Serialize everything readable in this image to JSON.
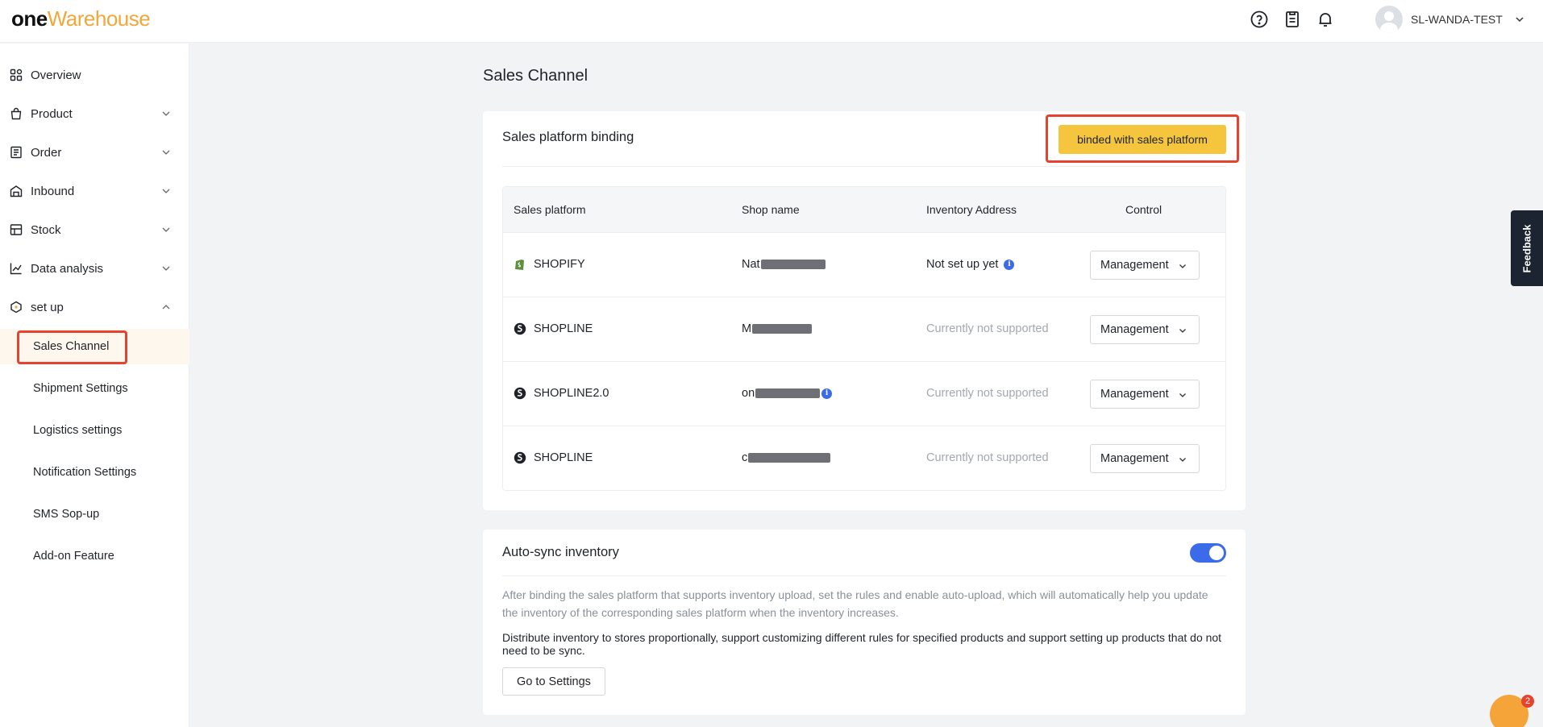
{
  "header": {
    "logo_one": "one",
    "logo_rest": "Warehouse",
    "icons": [
      "help-circle-icon",
      "clipboard-icon",
      "bell-icon"
    ],
    "user_name": "SL-WANDA-TEST"
  },
  "sidebar": {
    "items": [
      {
        "label": "Overview",
        "icon": "grid-icon"
      },
      {
        "label": "Product",
        "icon": "bag-icon"
      },
      {
        "label": "Order",
        "icon": "order-list-icon"
      },
      {
        "label": "Inbound",
        "icon": "inbound-icon"
      },
      {
        "label": "Stock",
        "icon": "stock-icon"
      },
      {
        "label": "Data analysis",
        "icon": "chart-icon"
      },
      {
        "label": "set up",
        "icon": "hexagon-icon"
      }
    ],
    "setup_children": [
      {
        "label": "Sales Channel",
        "active": true
      },
      {
        "label": "Shipment Settings"
      },
      {
        "label": "Logistics settings"
      },
      {
        "label": "Notification Settings"
      },
      {
        "label": "SMS Sop-up"
      },
      {
        "label": "Add-on Feature"
      }
    ]
  },
  "main": {
    "page_title": "Sales Channel",
    "binding_card": {
      "title": "Sales platform binding",
      "bind_button": "binded with sales platform",
      "columns": [
        "Sales platform",
        "Shop name",
        "Inventory Address",
        "Control"
      ],
      "rows": [
        {
          "platform": "SHOPIFY",
          "platform_icon": "shopify-icon",
          "shop_prefix": "Nat",
          "inventory": "Not set up yet",
          "control": "Management"
        },
        {
          "platform": "SHOPLINE",
          "platform_icon": "shopline-icon",
          "shop_prefix": "M",
          "inventory": "Currently not supported",
          "control": "Management"
        },
        {
          "platform": "SHOPLINE2.0",
          "platform_icon": "shopline-icon",
          "shop_prefix": "on",
          "inventory": "Currently not supported",
          "control": "Management"
        },
        {
          "platform": "SHOPLINE",
          "platform_icon": "shopline-icon",
          "shop_prefix": "c",
          "inventory": "Currently not supported",
          "control": "Management"
        }
      ]
    },
    "autosync_card": {
      "title": "Auto-sync inventory",
      "toggle_on": true,
      "desc1": "After binding the sales platform that supports inventory upload, set the rules and enable auto-upload, which will automatically help you update the inventory of the corresponding sales platform when the inventory increases.",
      "desc2": "Distribute inventory to stores proportionally, support customizing different rules for specified products and support setting up products that do not need to be sync.",
      "settings_button": "Go to Settings"
    }
  },
  "feedback_label": "Feedback",
  "chat_badge_count": "2",
  "colors": {
    "brand_orange": "#f0a83a",
    "primary_button": "#f5c53e",
    "toggle_blue": "#3b6be8",
    "highlight_red": "#e5432f"
  }
}
